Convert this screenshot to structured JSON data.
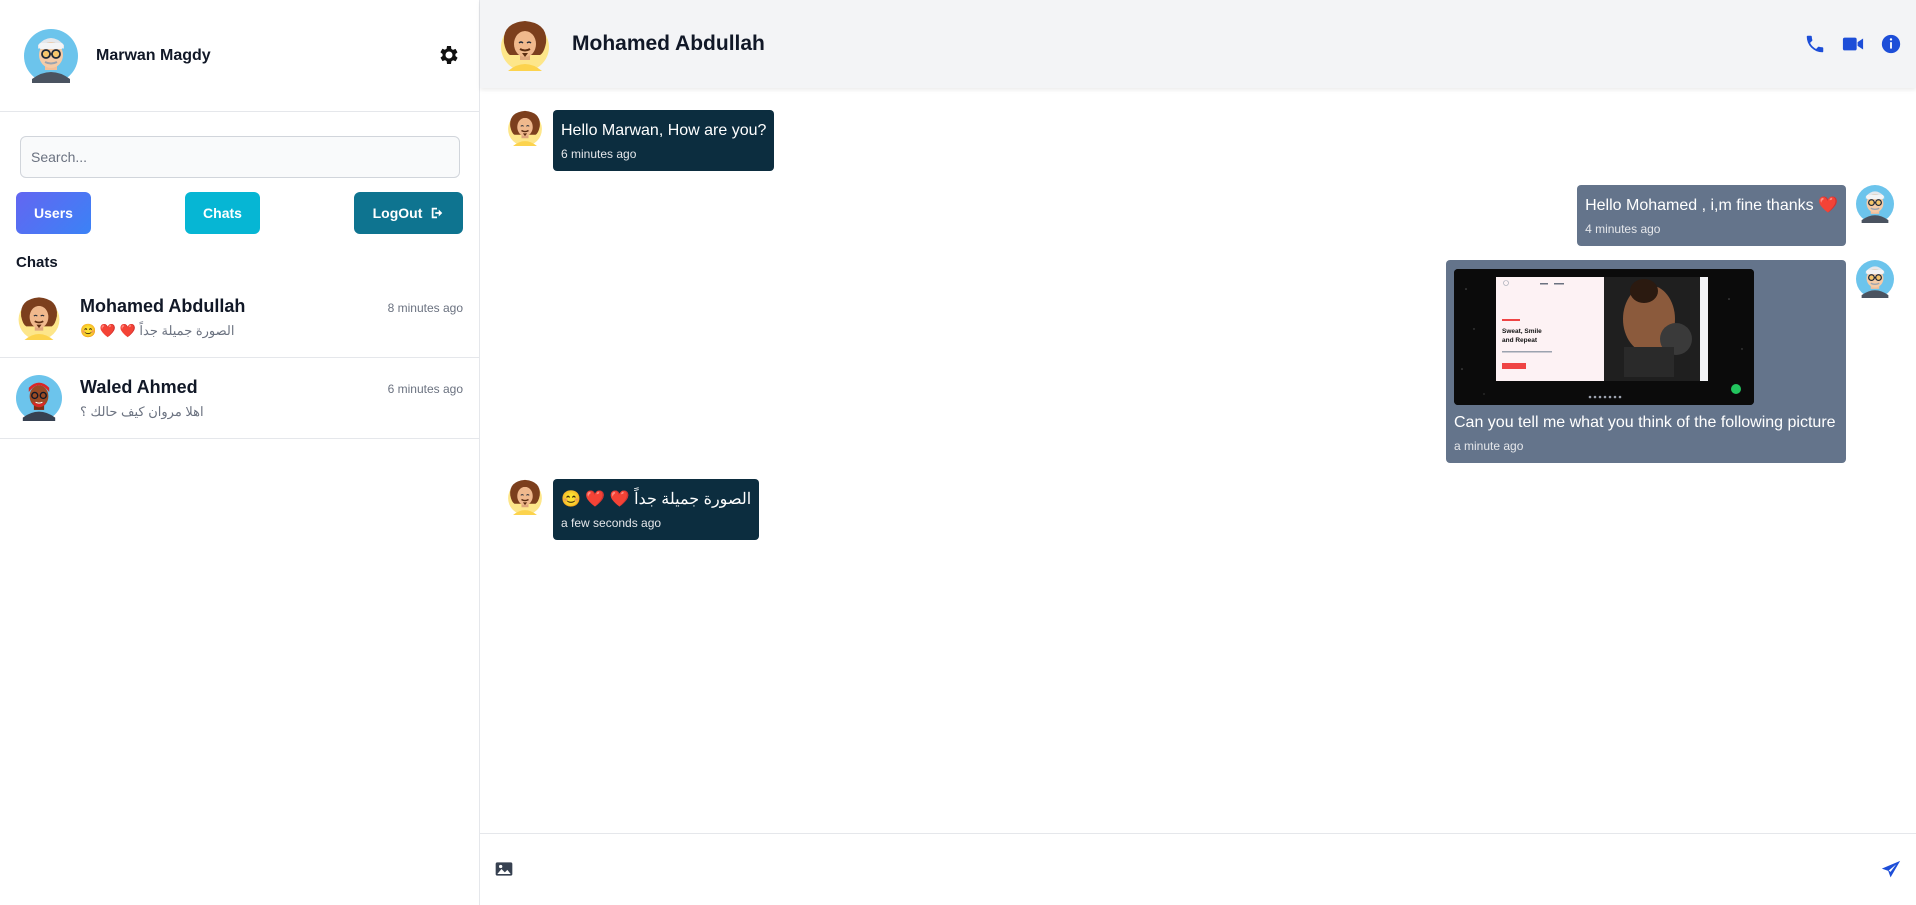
{
  "current_user": {
    "name": "Marwan Magdy"
  },
  "search": {
    "placeholder": "Search..."
  },
  "buttons": {
    "users": "Users",
    "chats": "Chats",
    "logout": "LogOut"
  },
  "sidebar": {
    "chats_title": "Chats",
    "chats": [
      {
        "name": "Mohamed Abdullah",
        "time": "8 minutes ago",
        "last_message": "الصورة جميلة جداً ❤️ ❤️ 😊"
      },
      {
        "name": "Waled Ahmed",
        "time": "6 minutes ago",
        "last_message": "اهلا مروان كيف حالك ؟"
      }
    ]
  },
  "conversation": {
    "contact_name": "Mohamed Abdullah",
    "messages": [
      {
        "direction": "in",
        "text": "Hello Marwan, How are you?",
        "time": "6 minutes ago"
      },
      {
        "direction": "out",
        "text": "Hello Mohamed , i,m fine thanks ❤️",
        "time": "4 minutes ago"
      },
      {
        "direction": "out",
        "text": "Can you tell me what you think of the following picture",
        "time": "a minute ago",
        "image_text": {
          "heading1": "Sweat, Smile",
          "heading2": "and Repeat"
        }
      },
      {
        "direction": "in",
        "text": "الصورة جميلة جداً ❤️ ❤️ 😊",
        "time": "a few seconds ago"
      }
    ]
  },
  "icons": {
    "settings": "gear-icon",
    "phone": "phone-icon",
    "video": "video-icon",
    "info": "info-icon",
    "image": "image-icon",
    "send": "send-icon",
    "logout": "logout-icon"
  },
  "colors": {
    "incoming_bubble": "#0c2d3f",
    "outgoing_bubble": "#64748b",
    "accent_blue": "#1d4ed8",
    "users_button": "#6366f1",
    "chats_button": "#06b6d4",
    "logout_button": "#0e7490"
  }
}
